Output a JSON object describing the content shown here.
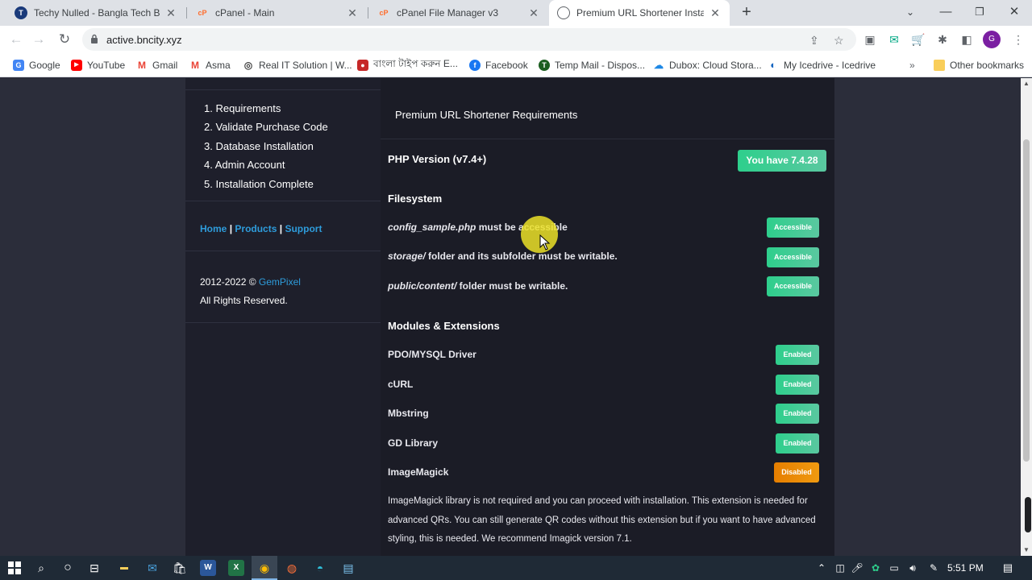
{
  "browser": {
    "tabs": [
      {
        "title": "Techy Nulled - Bangla Tech Blogg",
        "icon": "techy-icon",
        "icon_text": "T",
        "active": false
      },
      {
        "title": "cPanel - Main",
        "icon": "cpanel-icon",
        "icon_text": "cP",
        "active": false
      },
      {
        "title": "cPanel File Manager v3",
        "icon": "cpanel-icon",
        "icon_text": "cP",
        "active": false
      },
      {
        "title": "Premium URL Shortener Installati",
        "icon": "globe-icon",
        "icon_text": "",
        "active": true
      }
    ],
    "url": "active.bncity.xyz",
    "profile_initial": "G",
    "bookmarks": [
      {
        "label": "Google",
        "icon": "google-icon",
        "color": "#4285f4",
        "glyph": "G"
      },
      {
        "label": "YouTube",
        "icon": "youtube-icon",
        "color": "#ff0000",
        "glyph": "▶"
      },
      {
        "label": "Gmail",
        "icon": "gmail-icon",
        "color": "#ea4335",
        "glyph": "M"
      },
      {
        "label": "Asma",
        "icon": "gmail-icon",
        "color": "#ea4335",
        "glyph": "M"
      },
      {
        "label": "Real IT Solution | W...",
        "icon": "globe-icon",
        "color": "#444444",
        "glyph": "◎"
      },
      {
        "label": "বাংলা টাইপ করুন E...",
        "icon": "bangla-icon",
        "color": "#c62828",
        "glyph": "●"
      },
      {
        "label": "Facebook",
        "icon": "facebook-icon",
        "color": "#1877f2",
        "glyph": "f"
      },
      {
        "label": "Temp Mail - Dispos...",
        "icon": "tempmail-icon",
        "color": "#1b5e20",
        "glyph": "T"
      },
      {
        "label": "Dubox: Cloud Stora...",
        "icon": "dubox-icon",
        "color": "#1e88e5",
        "glyph": "☁"
      },
      {
        "label": "My Icedrive - Icedrive",
        "icon": "icedrive-icon",
        "color": "#1565c0",
        "glyph": "◐"
      }
    ],
    "other_bookmarks": "Other bookmarks"
  },
  "sidebar": {
    "steps": [
      "1. Requirements",
      "2. Validate Purchase Code",
      "3. Database Installation",
      "4. Admin Account",
      "5. Installation Complete"
    ],
    "links": {
      "home": "Home",
      "products": "Products",
      "support": "Support",
      "separator": "|"
    },
    "copyright_prefix": "2012-2022 ©",
    "copyright_brand": "GemPixel",
    "rights": "All Rights Reserved."
  },
  "main": {
    "header": "Premium URL Shortener Requirements",
    "php": {
      "label": "PHP Version (v7.4+)",
      "badge": "You have 7.4.28"
    },
    "filesystem": {
      "title": "Filesystem",
      "items": [
        {
          "em": "config_sample.php",
          "text": " must be accessible",
          "badge": "Accessible"
        },
        {
          "em": "storage/",
          "text": " folder and its subfolder must be writable.",
          "badge": "Accessible"
        },
        {
          "em": "public/content/",
          "text": " folder must be writable.",
          "badge": "Accessible"
        }
      ]
    },
    "modules": {
      "title": "Modules & Extensions",
      "items": [
        {
          "label": "PDO/MYSQL Driver",
          "badge": "Enabled",
          "status": "ok"
        },
        {
          "label": "cURL",
          "badge": "Enabled",
          "status": "ok"
        },
        {
          "label": "Mbstring",
          "badge": "Enabled",
          "status": "ok"
        },
        {
          "label": "GD Library",
          "badge": "Enabled",
          "status": "ok"
        },
        {
          "label": "ImageMagick",
          "badge": "Disabled",
          "status": "warn"
        }
      ]
    },
    "note": "ImageMagick library is not required and you can proceed with installation. This extension is needed for advanced QRs. You can still generate QR codes without this extension but if you want to have advanced styling, this is needed. We recommend Imagick version 7.1."
  },
  "colors": {
    "accent_green": "#2ecf8c",
    "warn_orange": "#e67e00",
    "link_blue": "#2e9cdb"
  },
  "taskbar": {
    "time": "5:51 PM"
  }
}
